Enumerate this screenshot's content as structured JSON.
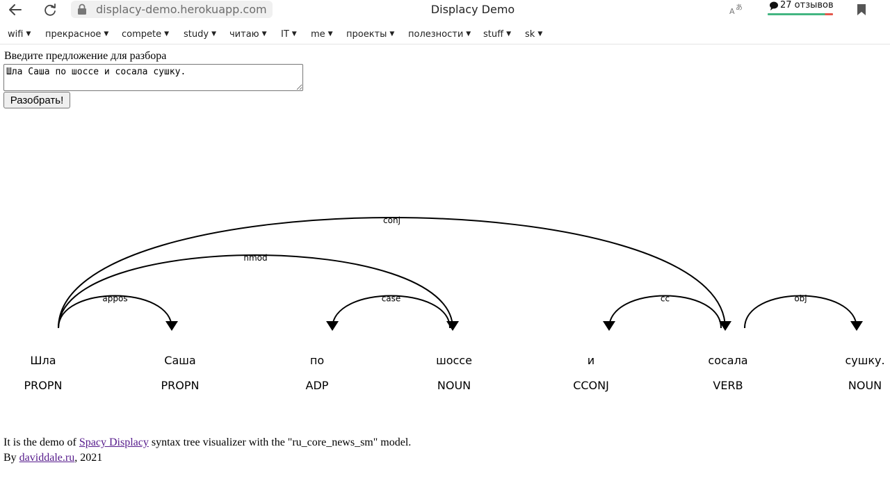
{
  "browser": {
    "url": "displacy-demo.herokuapp.com",
    "title": "Displacy Demo",
    "reviews_label": "27 отзывов"
  },
  "menu": {
    "items": [
      "wifi",
      "прекрасное",
      "compete",
      "study",
      "читаю",
      "IT",
      "me",
      "проекты",
      "полезности",
      "stuff",
      "sk"
    ]
  },
  "form": {
    "prompt": "Введите предложение для разбора",
    "input_value": "Шла Саша по шоссе и сосала сушку.",
    "button_label": "Разобрать!"
  },
  "parse": {
    "words": [
      {
        "text": "Шла",
        "tag": "PROPN"
      },
      {
        "text": "Саша",
        "tag": "PROPN"
      },
      {
        "text": "по",
        "tag": "ADP"
      },
      {
        "text": "шоссе",
        "tag": "NOUN"
      },
      {
        "text": "и",
        "tag": "CCONJ"
      },
      {
        "text": "сосала",
        "tag": "VERB"
      },
      {
        "text": "сушку.",
        "tag": "NOUN"
      }
    ],
    "arcs": [
      {
        "start": 0,
        "end": 5,
        "label": "conj",
        "dir": "right"
      },
      {
        "start": 0,
        "end": 3,
        "label": "nmod",
        "dir": "right"
      },
      {
        "start": 0,
        "end": 1,
        "label": "appos",
        "dir": "right"
      },
      {
        "start": 2,
        "end": 3,
        "label": "case",
        "dir": "left"
      },
      {
        "start": 4,
        "end": 5,
        "label": "cc",
        "dir": "left"
      },
      {
        "start": 5,
        "end": 6,
        "label": "obj",
        "dir": "right"
      }
    ]
  },
  "footer": {
    "line1_prefix": "It is the demo of ",
    "line1_link": "Spacy Displacy",
    "line1_suffix": " syntax tree visualizer with the \"ru_core_news_sm\" model.",
    "line2_prefix": "By ",
    "line2_link": "daviddale.ru",
    "line2_suffix": ", 2021"
  }
}
